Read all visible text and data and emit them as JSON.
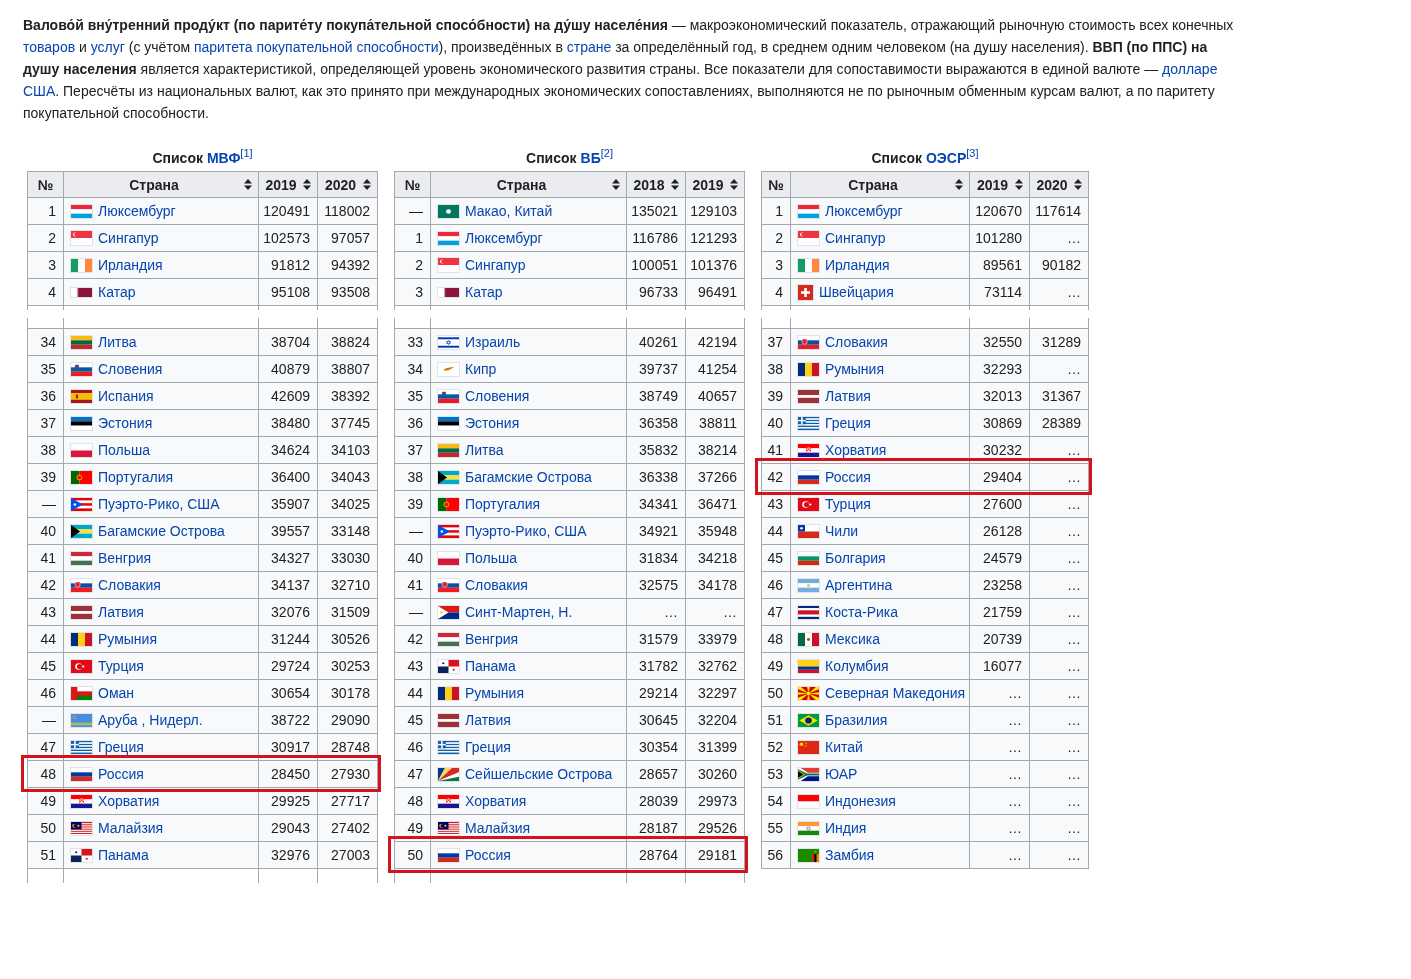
{
  "intro": {
    "segments": [
      {
        "kind": "text",
        "text": "**Валово́й вну́тренний проду́кт (по парите́ту покупа́тельной спосо́бности) на ду́шу населе́ния** — макроэкономический показатель, отражающий рыночную стоимость всех конечных "
      },
      {
        "kind": "link",
        "text": "товаров"
      },
      {
        "kind": "text",
        "text": " и "
      },
      {
        "kind": "link",
        "text": "услуг"
      },
      {
        "kind": "text",
        "text": " (с учётом "
      },
      {
        "kind": "link",
        "text": "паритета покупательной способности"
      },
      {
        "kind": "text",
        "text": "), произведённых в "
      },
      {
        "kind": "link",
        "text": "стране"
      },
      {
        "kind": "text",
        "text": " за определённый год, в среднем одним человеком (на душу населения). **ВВП (по ППС) на душу населения** является характеристикой, определяющей уровень экономического развития страны. Все показатели для сопоставимости выражаются в единой валюте — "
      },
      {
        "kind": "link",
        "text": "долларе"
      },
      {
        "kind": "link",
        "text": "США"
      },
      {
        "kind": "text",
        "text": ". Пересчёты из национальных валют, как это принято при международных экономических сопоставлениях, выполняются не по рыночным обменным курсам валют, а по паритету покупательной способности."
      }
    ]
  },
  "tables": [
    {
      "caption": {
        "label": "Список",
        "link": "МВФ",
        "ref": "[1]"
      },
      "columns": [
        {
          "label": "№",
          "sortable": false
        },
        {
          "label": "Страна",
          "sortable": true
        },
        {
          "label": "2019",
          "sortable": true
        },
        {
          "label": "2020",
          "sortable": true
        }
      ],
      "parts": [
        {
          "partial_row_after": true,
          "rows": [
            {
              "rank": "1",
              "flag": {
                "kind": "lu"
              },
              "country": "Люксембург",
              "values": [
                "120491",
                "118002"
              ],
              "highlighted": false
            },
            {
              "rank": "2",
              "flag": {
                "kind": "sg"
              },
              "country": "Сингапур",
              "values": [
                "102573",
                "97057"
              ],
              "highlighted": false
            },
            {
              "rank": "3",
              "flag": {
                "kind": "ie"
              },
              "country": "Ирландия",
              "values": [
                "91812",
                "94392"
              ],
              "highlighted": false
            },
            {
              "rank": "4",
              "flag": {
                "kind": "qa"
              },
              "country": "Катар",
              "values": [
                "95108",
                "93508"
              ],
              "highlighted": false
            }
          ]
        },
        {
          "partial_row_before": true,
          "partial_row_after": true,
          "rows": [
            {
              "rank": "34",
              "flag": {
                "kind": "lt"
              },
              "country": "Литва",
              "values": [
                "38704",
                "38824"
              ],
              "highlighted": false
            },
            {
              "rank": "35",
              "flag": {
                "kind": "si"
              },
              "country": "Словения",
              "values": [
                "40879",
                "38807"
              ],
              "highlighted": false
            },
            {
              "rank": "36",
              "flag": {
                "kind": "es"
              },
              "country": "Испания",
              "values": [
                "42609",
                "38392"
              ],
              "highlighted": false
            },
            {
              "rank": "37",
              "flag": {
                "kind": "ee"
              },
              "country": "Эстония",
              "values": [
                "38480",
                "37745"
              ],
              "highlighted": false
            },
            {
              "rank": "38",
              "flag": {
                "kind": "pl"
              },
              "country": "Польша",
              "values": [
                "34624",
                "34103"
              ],
              "highlighted": false
            },
            {
              "rank": "39",
              "flag": {
                "kind": "pt"
              },
              "country": "Португалия",
              "values": [
                "36400",
                "34043"
              ],
              "highlighted": false
            },
            {
              "rank": "—",
              "flag": {
                "kind": "pr"
              },
              "country": "Пуэрто-Рико, США",
              "values": [
                "35907",
                "34025"
              ],
              "highlighted": false
            },
            {
              "rank": "40",
              "flag": {
                "kind": "bs"
              },
              "country": "Багамские Острова",
              "values": [
                "39557",
                "33148"
              ],
              "highlighted": false
            },
            {
              "rank": "41",
              "flag": {
                "kind": "hu"
              },
              "country": "Венгрия",
              "values": [
                "34327",
                "33030"
              ],
              "highlighted": false
            },
            {
              "rank": "42",
              "flag": {
                "kind": "sk"
              },
              "country": "Словакия",
              "values": [
                "34137",
                "32710"
              ],
              "highlighted": false
            },
            {
              "rank": "43",
              "flag": {
                "kind": "lv"
              },
              "country": "Латвия",
              "values": [
                "32076",
                "31509"
              ],
              "highlighted": false
            },
            {
              "rank": "44",
              "flag": {
                "kind": "ro"
              },
              "country": "Румыния",
              "values": [
                "31244",
                "30526"
              ],
              "highlighted": false
            },
            {
              "rank": "45",
              "flag": {
                "kind": "tr"
              },
              "country": "Турция",
              "values": [
                "29724",
                "30253"
              ],
              "highlighted": false
            },
            {
              "rank": "46",
              "flag": {
                "kind": "om"
              },
              "country": "Оман",
              "values": [
                "30654",
                "30178"
              ],
              "highlighted": false
            },
            {
              "rank": "—",
              "flag": {
                "kind": "aw"
              },
              "country": "Аруба , Нидерл.",
              "values": [
                "38722",
                "29090"
              ],
              "highlighted": false
            },
            {
              "rank": "47",
              "flag": {
                "kind": "gr"
              },
              "country": "Греция",
              "values": [
                "30917",
                "28748"
              ],
              "highlighted": false
            },
            {
              "rank": "48",
              "flag": {
                "kind": "ru"
              },
              "country": "Россия",
              "values": [
                "28450",
                "27930"
              ],
              "highlighted": true
            },
            {
              "rank": "49",
              "flag": {
                "kind": "hr"
              },
              "country": "Хорватия",
              "values": [
                "29925",
                "27717"
              ],
              "highlighted": false
            },
            {
              "rank": "50",
              "flag": {
                "kind": "my"
              },
              "country": "Малайзия",
              "values": [
                "29043",
                "27402"
              ],
              "highlighted": false
            },
            {
              "rank": "51",
              "flag": {
                "kind": "pa"
              },
              "country": "Панама",
              "values": [
                "32976",
                "27003"
              ],
              "highlighted": false
            }
          ]
        }
      ]
    },
    {
      "caption": {
        "label": "Список",
        "link": "ВБ",
        "ref": "[2]"
      },
      "columns": [
        {
          "label": "№",
          "sortable": false
        },
        {
          "label": "Страна",
          "sortable": true
        },
        {
          "label": "2018",
          "sortable": true
        },
        {
          "label": "2019",
          "sortable": true
        }
      ],
      "parts": [
        {
          "partial_row_after": true,
          "rows": [
            {
              "rank": "—",
              "flag": {
                "kind": "mo"
              },
              "country": "Макао, Китай",
              "values": [
                "135021",
                "129103"
              ],
              "highlighted": false
            },
            {
              "rank": "1",
              "flag": {
                "kind": "lu"
              },
              "country": "Люксембург",
              "values": [
                "116786",
                "121293"
              ],
              "highlighted": false
            },
            {
              "rank": "2",
              "flag": {
                "kind": "sg"
              },
              "country": "Сингапур",
              "values": [
                "100051",
                "101376"
              ],
              "highlighted": false
            },
            {
              "rank": "3",
              "flag": {
                "kind": "qa"
              },
              "country": "Катар",
              "values": [
                "96733",
                "96491"
              ],
              "highlighted": false
            }
          ]
        },
        {
          "partial_row_before": true,
          "partial_row_after": true,
          "rows": [
            {
              "rank": "33",
              "flag": {
                "kind": "il"
              },
              "country": "Израиль",
              "values": [
                "40261",
                "42194"
              ],
              "highlighted": false
            },
            {
              "rank": "34",
              "flag": {
                "kind": "cy"
              },
              "country": "Кипр",
              "values": [
                "39737",
                "41254"
              ],
              "highlighted": false
            },
            {
              "rank": "35",
              "flag": {
                "kind": "si"
              },
              "country": "Словения",
              "values": [
                "38749",
                "40657"
              ],
              "highlighted": false
            },
            {
              "rank": "36",
              "flag": {
                "kind": "ee"
              },
              "country": "Эстония",
              "values": [
                "36358",
                "38811"
              ],
              "highlighted": false
            },
            {
              "rank": "37",
              "flag": {
                "kind": "lt"
              },
              "country": "Литва",
              "values": [
                "35832",
                "38214"
              ],
              "highlighted": false
            },
            {
              "rank": "38",
              "flag": {
                "kind": "bs"
              },
              "country": "Багамские Острова",
              "values": [
                "36338",
                "37266"
              ],
              "highlighted": false
            },
            {
              "rank": "39",
              "flag": {
                "kind": "pt"
              },
              "country": "Португалия",
              "values": [
                "34341",
                "36471"
              ],
              "highlighted": false
            },
            {
              "rank": "—",
              "flag": {
                "kind": "pr"
              },
              "country": "Пуэрто-Рико, США",
              "values": [
                "34921",
                "35948"
              ],
              "highlighted": false
            },
            {
              "rank": "40",
              "flag": {
                "kind": "pl"
              },
              "country": "Польша",
              "values": [
                "31834",
                "34218"
              ],
              "highlighted": false
            },
            {
              "rank": "41",
              "flag": {
                "kind": "sk"
              },
              "country": "Словакия",
              "values": [
                "32575",
                "34178"
              ],
              "highlighted": false
            },
            {
              "rank": "—",
              "flag": {
                "kind": "sx"
              },
              "country": "Синт-Мартен, Н.",
              "values": [
                "…",
                "…"
              ],
              "highlighted": false
            },
            {
              "rank": "42",
              "flag": {
                "kind": "hu"
              },
              "country": "Венгрия",
              "values": [
                "31579",
                "33979"
              ],
              "highlighted": false
            },
            {
              "rank": "43",
              "flag": {
                "kind": "pa"
              },
              "country": "Панама",
              "values": [
                "31782",
                "32762"
              ],
              "highlighted": false
            },
            {
              "rank": "44",
              "flag": {
                "kind": "ro"
              },
              "country": "Румыния",
              "values": [
                "29214",
                "32297"
              ],
              "highlighted": false
            },
            {
              "rank": "45",
              "flag": {
                "kind": "lv"
              },
              "country": "Латвия",
              "values": [
                "30645",
                "32204"
              ],
              "highlighted": false
            },
            {
              "rank": "46",
              "flag": {
                "kind": "gr"
              },
              "country": "Греция",
              "values": [
                "30354",
                "31399"
              ],
              "highlighted": false
            },
            {
              "rank": "47",
              "flag": {
                "kind": "sc"
              },
              "country": "Сейшельские Острова",
              "values": [
                "28657",
                "30260"
              ],
              "highlighted": false
            },
            {
              "rank": "48",
              "flag": {
                "kind": "hr"
              },
              "country": "Хорватия",
              "values": [
                "28039",
                "29973"
              ],
              "highlighted": false
            },
            {
              "rank": "49",
              "flag": {
                "kind": "my"
              },
              "country": "Малайзия",
              "values": [
                "28187",
                "29526"
              ],
              "highlighted": false
            },
            {
              "rank": "50",
              "flag": {
                "kind": "ru"
              },
              "country": "Россия",
              "values": [
                "28764",
                "29181"
              ],
              "highlighted": true
            }
          ]
        }
      ]
    },
    {
      "caption": {
        "label": "Список",
        "link": "ОЭСР",
        "ref": "[3]"
      },
      "columns": [
        {
          "label": "№",
          "sortable": false
        },
        {
          "label": "Страна",
          "sortable": true
        },
        {
          "label": "2019",
          "sortable": true
        },
        {
          "label": "2020",
          "sortable": true
        }
      ],
      "parts": [
        {
          "partial_row_after": true,
          "rows": [
            {
              "rank": "1",
              "flag": {
                "kind": "lu"
              },
              "country": "Люксембург",
              "values": [
                "120670",
                "117614"
              ],
              "highlighted": false
            },
            {
              "rank": "2",
              "flag": {
                "kind": "sg"
              },
              "country": "Сингапур",
              "values": [
                "101280",
                "…"
              ],
              "highlighted": false
            },
            {
              "rank": "3",
              "flag": {
                "kind": "ie"
              },
              "country": "Ирландия",
              "values": [
                "89561",
                "90182"
              ],
              "highlighted": false
            },
            {
              "rank": "4",
              "flag": {
                "kind": "ch"
              },
              "country": "Швейцария",
              "values": [
                "73114",
                "…"
              ],
              "highlighted": false
            }
          ]
        },
        {
          "partial_row_before": true,
          "rows": [
            {
              "rank": "37",
              "flag": {
                "kind": "sk"
              },
              "country": "Словакия",
              "values": [
                "32550",
                "31289"
              ],
              "highlighted": false
            },
            {
              "rank": "38",
              "flag": {
                "kind": "ro"
              },
              "country": "Румыния",
              "values": [
                "32293",
                "…"
              ],
              "highlighted": false
            },
            {
              "rank": "39",
              "flag": {
                "kind": "lv"
              },
              "country": "Латвия",
              "values": [
                "32013",
                "31367"
              ],
              "highlighted": false
            },
            {
              "rank": "40",
              "flag": {
                "kind": "gr"
              },
              "country": "Греция",
              "values": [
                "30869",
                "28389"
              ],
              "highlighted": false
            },
            {
              "rank": "41",
              "flag": {
                "kind": "hr"
              },
              "country": "Хорватия",
              "values": [
                "30232",
                "…"
              ],
              "highlighted": false
            },
            {
              "rank": "42",
              "flag": {
                "kind": "ru"
              },
              "country": "Россия",
              "values": [
                "29404",
                "…"
              ],
              "highlighted": true
            },
            {
              "rank": "43",
              "flag": {
                "kind": "tr"
              },
              "country": "Турция",
              "values": [
                "27600",
                "…"
              ],
              "highlighted": false
            },
            {
              "rank": "44",
              "flag": {
                "kind": "cl"
              },
              "country": "Чили",
              "values": [
                "26128",
                "…"
              ],
              "highlighted": false
            },
            {
              "rank": "45",
              "flag": {
                "kind": "bg"
              },
              "country": "Болгария",
              "values": [
                "24579",
                "…"
              ],
              "highlighted": false
            },
            {
              "rank": "46",
              "flag": {
                "kind": "ar"
              },
              "country": "Аргентина",
              "values": [
                "23258",
                "…"
              ],
              "highlighted": false
            },
            {
              "rank": "47",
              "flag": {
                "kind": "cr"
              },
              "country": "Коста-Рика",
              "values": [
                "21759",
                "…"
              ],
              "highlighted": false
            },
            {
              "rank": "48",
              "flag": {
                "kind": "mx"
              },
              "country": "Мексика",
              "values": [
                "20739",
                "…"
              ],
              "highlighted": false
            },
            {
              "rank": "49",
              "flag": {
                "kind": "co"
              },
              "country": "Колумбия",
              "values": [
                "16077",
                "…"
              ],
              "highlighted": false
            },
            {
              "rank": "50",
              "flag": {
                "kind": "mk"
              },
              "country": "Северная Македония",
              "values": [
                "…",
                "…"
              ],
              "highlighted": false
            },
            {
              "rank": "51",
              "flag": {
                "kind": "br"
              },
              "country": "Бразилия",
              "values": [
                "…",
                "…"
              ],
              "highlighted": false
            },
            {
              "rank": "52",
              "flag": {
                "kind": "cn"
              },
              "country": "Китай",
              "values": [
                "…",
                "…"
              ],
              "highlighted": false
            },
            {
              "rank": "53",
              "flag": {
                "kind": "za"
              },
              "country": "ЮАР",
              "values": [
                "…",
                "…"
              ],
              "highlighted": false
            },
            {
              "rank": "54",
              "flag": {
                "kind": "id"
              },
              "country": "Индонезия",
              "values": [
                "…",
                "…"
              ],
              "highlighted": false
            },
            {
              "rank": "55",
              "flag": {
                "kind": "in"
              },
              "country": "Индия",
              "values": [
                "…",
                "…"
              ],
              "highlighted": false
            },
            {
              "rank": "56",
              "flag": {
                "kind": "zm"
              },
              "country": "Замбия",
              "values": [
                "…",
                "…"
              ],
              "highlighted": false
            }
          ]
        }
      ]
    }
  ]
}
